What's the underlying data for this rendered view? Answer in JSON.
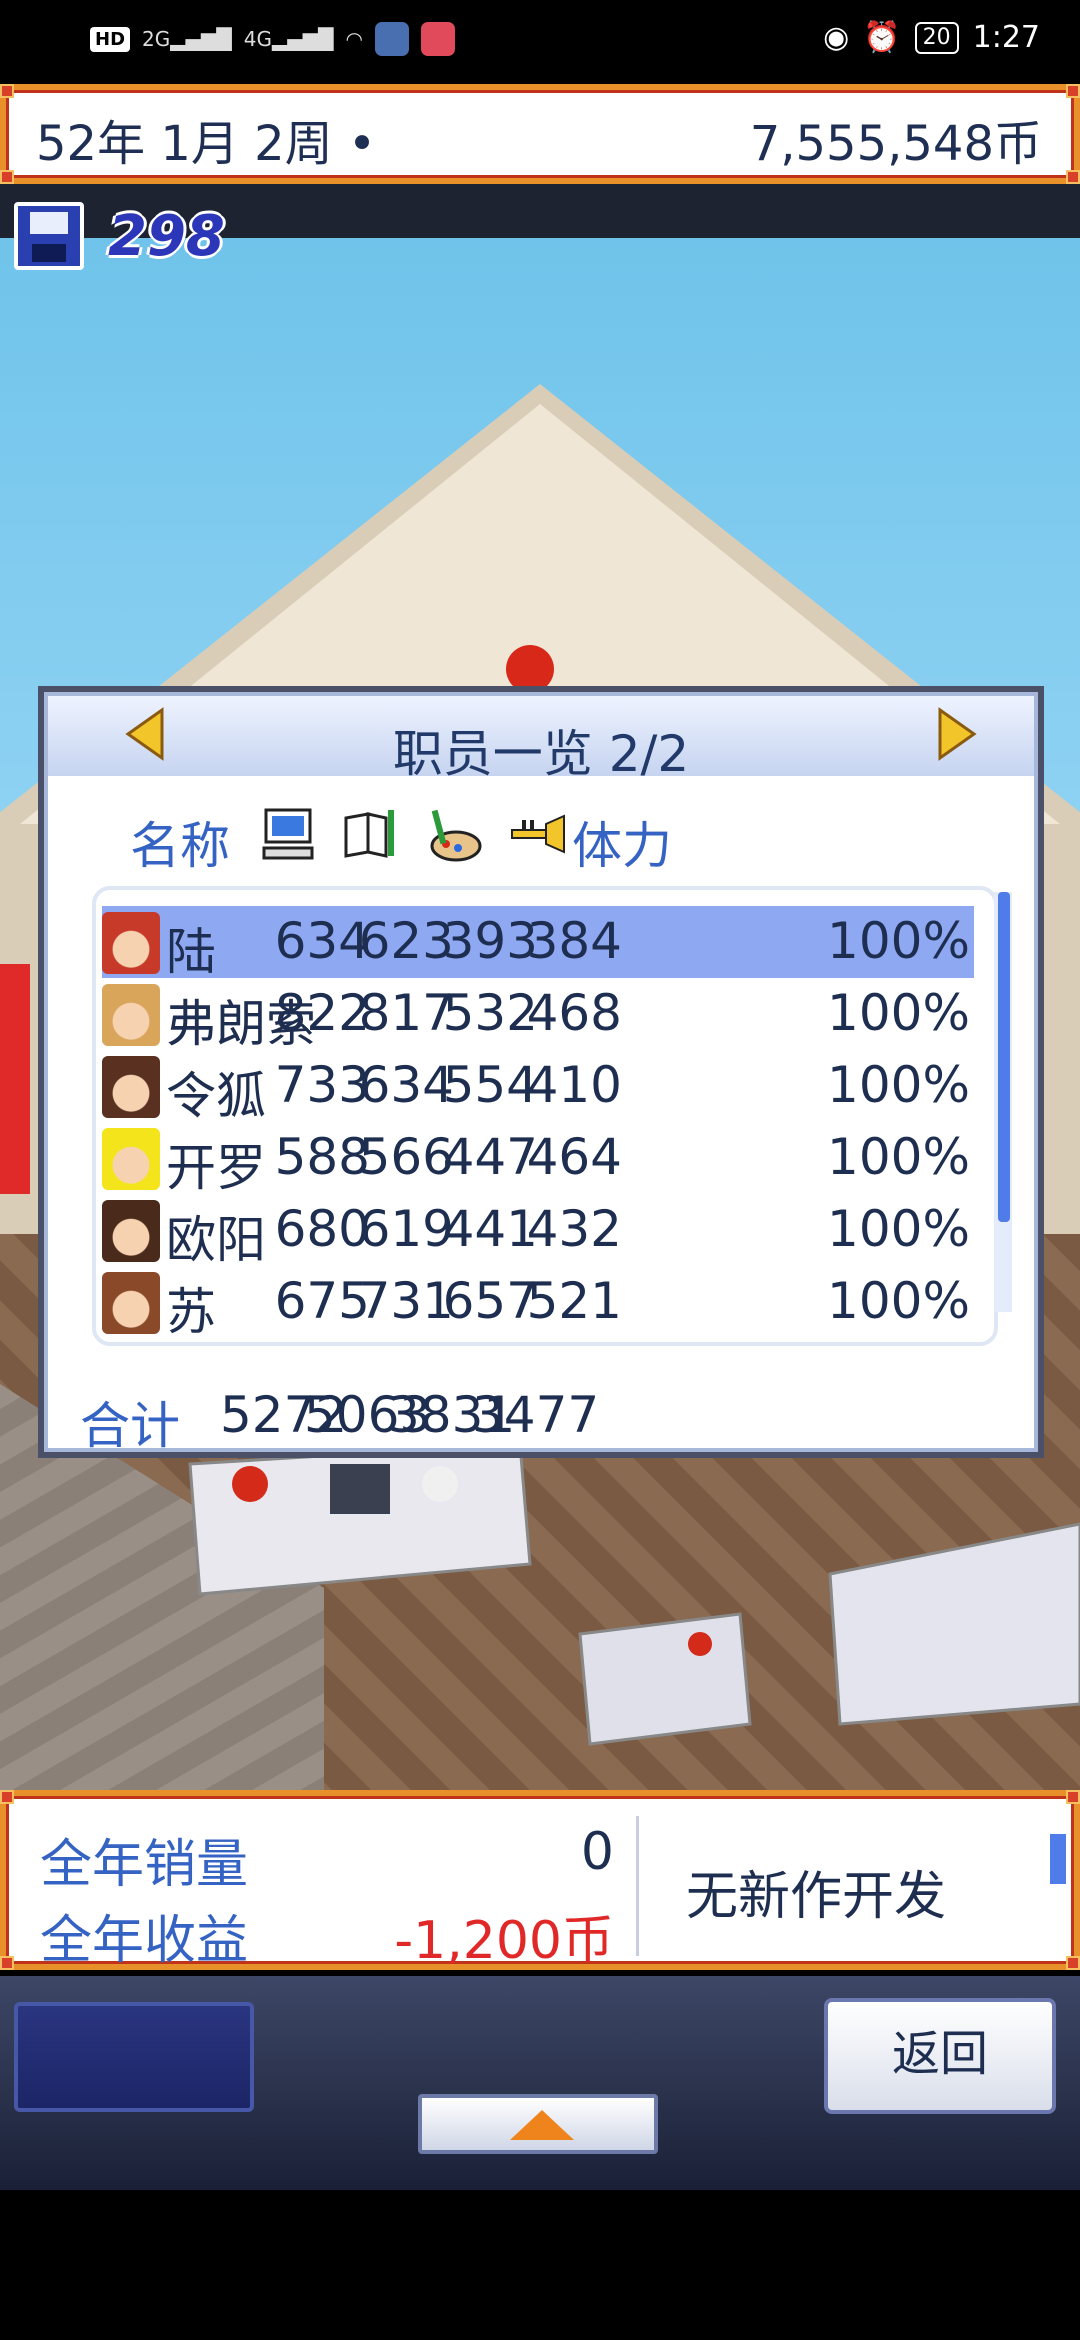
{
  "status_bar": {
    "time": "1:27",
    "battery": "20",
    "hd": "HD",
    "sig1": "2G",
    "sig2": "4G"
  },
  "header": {
    "date": "52年 1月 2周 •",
    "money": "7,555,548币",
    "research_points": "298"
  },
  "staff_dialog": {
    "title": "职员一览 2/2",
    "col_name": "名称",
    "col_stamina": "体力",
    "stat_icons": [
      "computer-icon",
      "book-icon",
      "paint-icon",
      "trumpet-icon"
    ],
    "rows": [
      {
        "name": "陆",
        "v1": "634",
        "v2": "623",
        "v3": "393",
        "v4": "384",
        "stamina": "100%",
        "selected": true,
        "avatar_color": "#c73a2a"
      },
      {
        "name": "弗朗索",
        "v1": "822",
        "v2": "817",
        "v3": "532",
        "v4": "468",
        "stamina": "100%",
        "selected": false,
        "avatar_color": "#d9a55a"
      },
      {
        "name": "令狐",
        "v1": "733",
        "v2": "634",
        "v3": "554",
        "v4": "410",
        "stamina": "100%",
        "selected": false,
        "avatar_color": "#5a3020"
      },
      {
        "name": "开罗",
        "v1": "588",
        "v2": "566",
        "v3": "447",
        "v4": "464",
        "stamina": "100%",
        "selected": false,
        "avatar_color": "#f4e41c"
      },
      {
        "name": "欧阳",
        "v1": "680",
        "v2": "619",
        "v3": "441",
        "v4": "432",
        "stamina": "100%",
        "selected": false,
        "avatar_color": "#4a2a1a"
      },
      {
        "name": "苏",
        "v1": "675",
        "v2": "731",
        "v3": "657",
        "v4": "521",
        "stamina": "100%",
        "selected": false,
        "avatar_color": "#8a4a2a"
      }
    ],
    "total_label": "合计",
    "totals": [
      "5272",
      "5063",
      "3831",
      "3477"
    ]
  },
  "info_panel": {
    "annual_sales_label": "全年销量",
    "annual_sales_value": "0",
    "annual_profit_label": "全年收益",
    "annual_profit_value": "-1,200币",
    "dev_status": "无新作开发"
  },
  "controls": {
    "back_label": "返回"
  }
}
